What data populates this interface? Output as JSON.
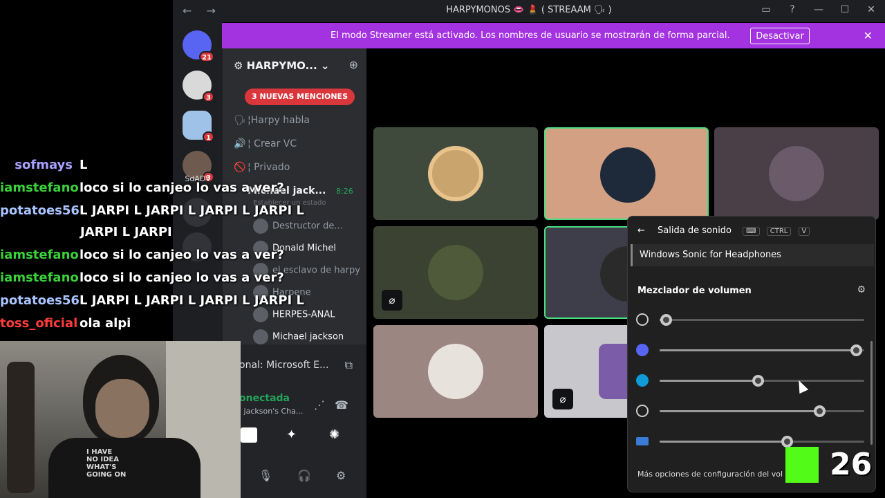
{
  "window": {
    "title": "HARPYMONOS 👄 💄 ( STREAAM 🗣 )",
    "controls": [
      "▭",
      "?",
      "—",
      "☐",
      "✕"
    ],
    "nav_arrows": "← →"
  },
  "guilds": {
    "items": [
      {
        "name": "discord-home",
        "badge": "21"
      },
      {
        "name": "server-1",
        "badge": "3"
      },
      {
        "name": "server-2",
        "badge": "1"
      },
      {
        "name": "server-3",
        "badge": "3"
      }
    ],
    "label": "SdADV"
  },
  "banner": {
    "text": "El modo Streamer está activado. Los nombres de usuario se mostrarán de forma parcial.",
    "button": "Desactivar",
    "close": "✕"
  },
  "sidebar": {
    "server_name": "HARPYMO...",
    "mentions": "3 NUEVAS MENCIONES",
    "channels": [
      {
        "icon": "🗣",
        "label": "¦Harpy habla"
      },
      {
        "icon": "🔊",
        "label": "¦ Crear VC"
      },
      {
        "icon": "🚫",
        "label": "¦ Privado"
      }
    ],
    "active_channel": "Michael jack...",
    "active_time": "8:26",
    "active_status": "Establecer un estado",
    "voice_users": [
      {
        "name": "Destructor de..."
      },
      {
        "name": "Donald Michel"
      },
      {
        "name": "el esclavo de harpy"
      },
      {
        "name": "Harpene"
      },
      {
        "name": "HERPES-ANAL"
      },
      {
        "name": "Michael jackson"
      }
    ],
    "activity": "onal: Microsoft E...",
    "connection": "onectada",
    "connection_sub": "l jackson's Cha..."
  },
  "mixer": {
    "header": "Salida de sonido",
    "kbd": [
      "CTRL",
      "V"
    ],
    "device": "Windows Sonic for Headphones",
    "title": "Mezclador de volumen",
    "rows": [
      {
        "app": "headphones-icon",
        "level": 0.03,
        "color": "#202020"
      },
      {
        "app": "discord-icon",
        "level": 0.96,
        "color": "#5865f2"
      },
      {
        "app": "edge-icon",
        "level": 0.48,
        "color": "#0f9bd7"
      },
      {
        "app": "obs-icon",
        "level": 0.78,
        "color": "#202020"
      },
      {
        "app": "app-icon",
        "level": 0.62,
        "color": "#3a7bd5"
      }
    ],
    "more": "Más opciones de configuración del volumen"
  },
  "chat": {
    "messages": [
      {
        "nick": "sofmays",
        "color": "#a8a2ff",
        "text": "L"
      },
      {
        "nick": "iamstefano",
        "color": "#3ad13a",
        "text": "loco si lo canjeo lo vas a ver?"
      },
      {
        "nick": "potatoes56",
        "color": "#a9c4ff",
        "text": "L JARPI L JARPI L JARPI L JARPI L"
      },
      {
        "nick": "iamstefano",
        "color": "#3ad13a",
        "text": "loco si lo canjeo lo vas a ver?"
      },
      {
        "nick": "iamstefano",
        "color": "#3ad13a",
        "text": "loco si lo canjeo lo vas a ver?"
      },
      {
        "nick": "potatoes56",
        "color": "#a9c4ff",
        "text": "L JARPI L JARPI L JARPI L JARPI L"
      },
      {
        "nick": "toss_oficial",
        "color": "#ff3b3b",
        "text": "ola alpi"
      }
    ],
    "continuation": "JARPI L JARPI"
  },
  "webcam": {
    "shirt_text": "I HAVE\nNO IDEA\nWHAT'S\nGOING ON"
  },
  "kick": {
    "count": "26"
  }
}
